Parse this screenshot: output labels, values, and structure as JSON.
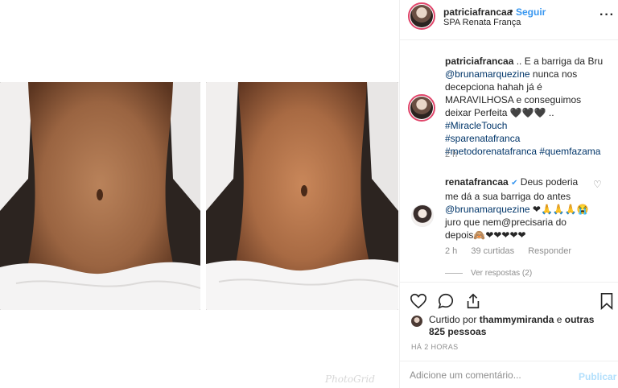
{
  "post": {
    "username": "patriciafrancaa",
    "separator": "•",
    "follow_label": "Seguir",
    "location": "SPA Renata França",
    "more_icon": "more-horizontal-icon"
  },
  "caption": {
    "username": "patriciafrancaa",
    "text_1": " .. E a barriga da Bru ",
    "mention": "@brunamarquezine",
    "text_2": " nunca nos decepciona hahah já é MARAVILHOSA e conseguimos deixar Perfeita ",
    "hearts": "🖤🖤🖤",
    "text_3": " .. ",
    "hashtag_1": "#MiracleTouch",
    "hashtag_2": "#sparenatafranca",
    "hashtag_3": "#metodorenatafranca",
    "hashtag_4": "#quemfazama",
    "time": "2 h"
  },
  "comment": {
    "username": "renatafrancaa",
    "verified": "✔",
    "text_1": " Deus poderia me dá a sua barriga do antes ",
    "mention": "@brunamarquezine",
    "emoji_1": " ❤🙏🙏🙏😭",
    "text_2": " juro que nem@precisaria do depois",
    "emoji_2": "🙈❤❤❤❤❤",
    "time": "2 h",
    "likes": "39 curtidas",
    "reply_label": "Responder",
    "view_replies": "Ver respostas (2)"
  },
  "likes": {
    "prefix": "Curtido por ",
    "user": "thammymiranda",
    "suffix": " e ",
    "others": "outras 825 pessoas"
  },
  "timestamp": "HÁ 2 HORAS",
  "comment_box": {
    "placeholder": "Adicione um comentário...",
    "publish_label": "Publicar"
  },
  "watermark": "PhotoGrid",
  "colors": {
    "accent": "#3897f0",
    "link": "#003569",
    "muted": "#8e8e8e",
    "ring": "#e0456a"
  }
}
